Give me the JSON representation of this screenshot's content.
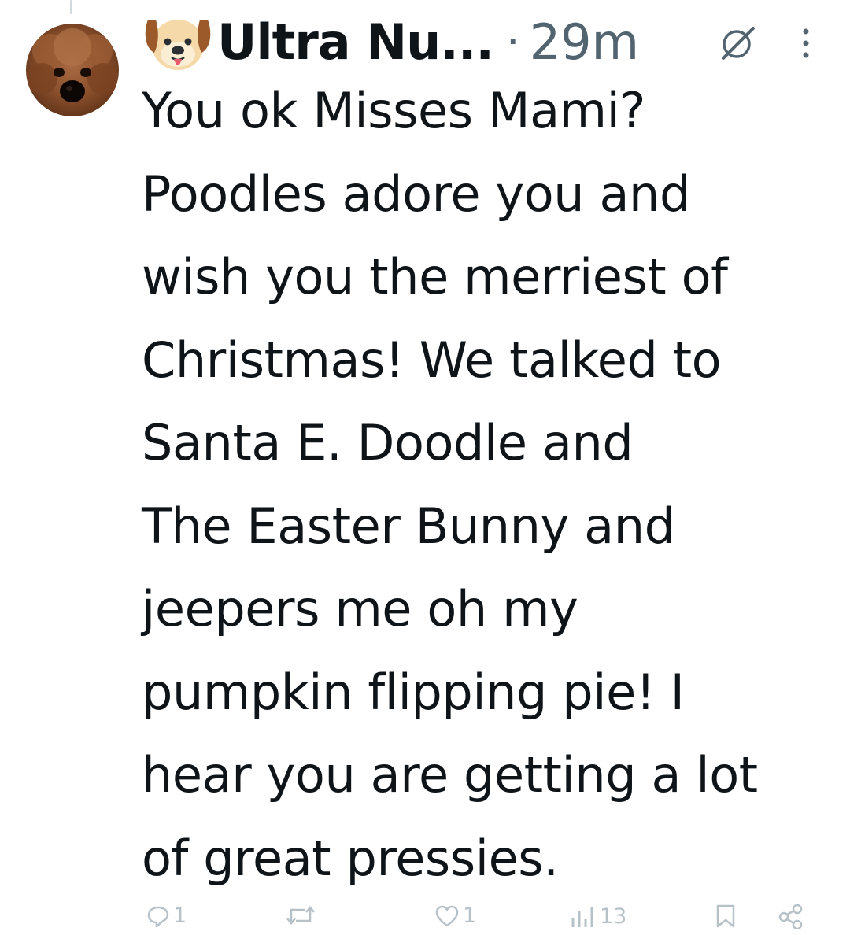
{
  "tweet": {
    "author": {
      "display_name": "Ultra Nu...",
      "avatar_icon": "poodle-avatar",
      "name_emoji": "dog-face-emoji"
    },
    "separator": "·",
    "timestamp": "29m",
    "text": "You ok Misses Mami?\nPoodles adore you and\nwish you the merriest of\nChristmas! We talked to\nSanta E. Doodle and\nThe Easter Bunny and\njeepers me oh my\npumpkin flipping pie! I\nhear you are getting a lot\nof great pressies.",
    "actions": {
      "reply_count": "1",
      "retweet_count": "",
      "like_count": "1",
      "views_count": "13"
    }
  },
  "colors": {
    "text": "#0f1419",
    "secondary": "#536471",
    "action_faded": "#b7c1c8"
  }
}
